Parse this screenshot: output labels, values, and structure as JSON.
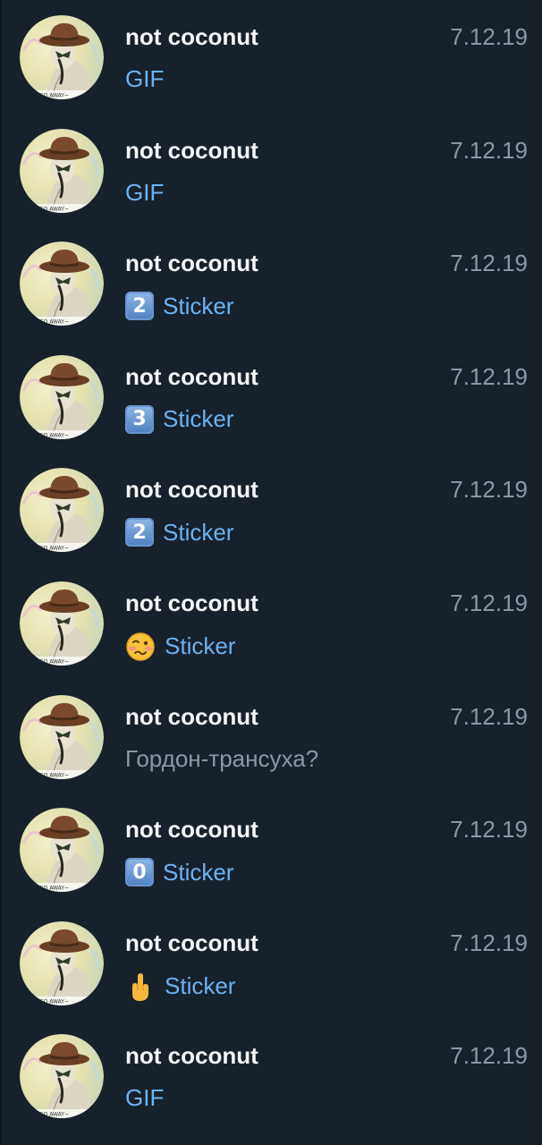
{
  "chats": [
    {
      "name": "not coconut",
      "date": "7.12.19",
      "preview": "GIF",
      "emoji": null,
      "emoji_text": ""
    },
    {
      "name": "not coconut",
      "date": "7.12.19",
      "preview": "GIF",
      "emoji": null,
      "emoji_text": ""
    },
    {
      "name": "not coconut",
      "date": "7.12.19",
      "preview": "Sticker",
      "emoji": "keycap-2-icon",
      "emoji_text": "2"
    },
    {
      "name": "not coconut",
      "date": "7.12.19",
      "preview": "Sticker",
      "emoji": "keycap-3-icon",
      "emoji_text": "3"
    },
    {
      "name": "not coconut",
      "date": "7.12.19",
      "preview": "Sticker",
      "emoji": "keycap-2-icon",
      "emoji_text": "2"
    },
    {
      "name": "not coconut",
      "date": "7.12.19",
      "preview": "Sticker",
      "emoji": "woozy-face-icon",
      "emoji_text": ""
    },
    {
      "name": "not coconut",
      "date": "7.12.19",
      "preview": "Гордон-трансуха?",
      "emoji": null,
      "emoji_text": ""
    },
    {
      "name": "not coconut",
      "date": "7.12.19",
      "preview": "Sticker",
      "emoji": "keycap-0-icon",
      "emoji_text": "0"
    },
    {
      "name": "not coconut",
      "date": "7.12.19",
      "preview": "Sticker",
      "emoji": "middle-finger-icon",
      "emoji_text": ""
    },
    {
      "name": "not coconut",
      "date": "7.12.19",
      "preview": "GIF",
      "emoji": null,
      "emoji_text": ""
    }
  ],
  "avatar_caption": "GO AWAY~",
  "colors": {
    "background": "#17212b",
    "name": "#f5f5f5",
    "date": "#8a98a6",
    "link_preview": "#6ab3f3",
    "text_preview": "#8a98a6"
  }
}
